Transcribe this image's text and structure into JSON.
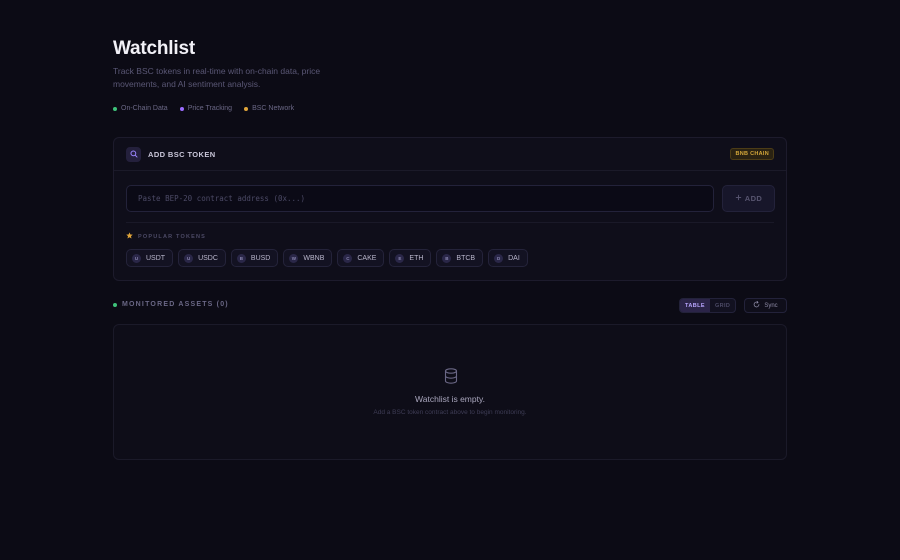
{
  "header": {
    "title": "Watchlist",
    "subtitle": "Track BSC tokens in real-time with on-chain data, price movements, and AI sentiment analysis.",
    "features": [
      {
        "label": "On-Chain Data",
        "color": "#3ec27a"
      },
      {
        "label": "Price Tracking",
        "color": "#9b6cff"
      },
      {
        "label": "BSC Network",
        "color": "#e0a53a"
      }
    ]
  },
  "add_token": {
    "title": "ADD BSC TOKEN",
    "chain_badge": "BNB CHAIN",
    "input_placeholder": "Paste BEP-20 contract address (0x...)",
    "input_value": "",
    "add_label": "ADD",
    "add_icon": "plus-icon",
    "popular_label": "POPULAR TOKENS",
    "popular_icon": "star-icon",
    "tokens": [
      {
        "symbol": "USDT",
        "initial": "U"
      },
      {
        "symbol": "USDC",
        "initial": "U"
      },
      {
        "symbol": "BUSD",
        "initial": "B"
      },
      {
        "symbol": "WBNB",
        "initial": "W"
      },
      {
        "symbol": "CAKE",
        "initial": "C"
      },
      {
        "symbol": "ETH",
        "initial": "E"
      },
      {
        "symbol": "BTCB",
        "initial": "B"
      },
      {
        "symbol": "DAI",
        "initial": "D"
      }
    ]
  },
  "assets": {
    "label": "MONITORED ASSETS (0)",
    "status_color": "#3ec27a",
    "view_options": [
      "TABLE",
      "GRID"
    ],
    "selected_view": "TABLE",
    "sync_label": "Sync",
    "empty_title": "Watchlist is empty.",
    "empty_subtitle": "Add a BSC token contract above to begin monitoring."
  },
  "colors": {
    "background": "#0c0b15",
    "accent": "#9b6cff",
    "warning": "#e0a53a"
  }
}
